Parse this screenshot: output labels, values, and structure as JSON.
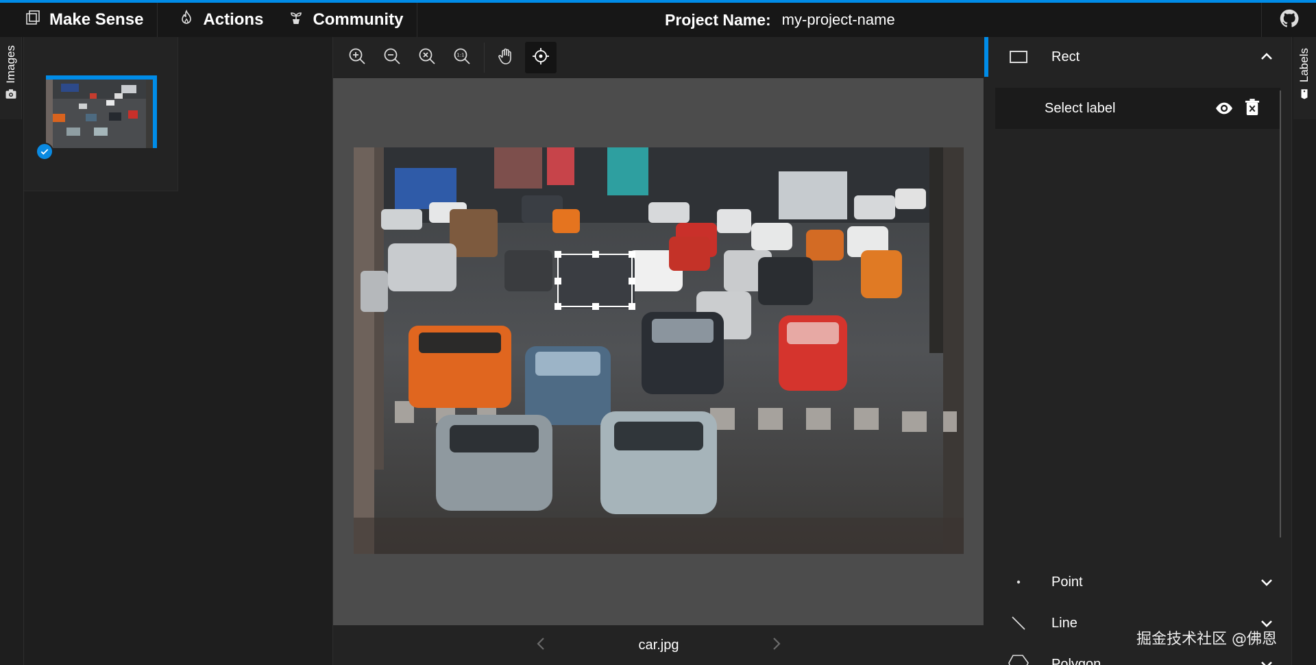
{
  "topbar": {
    "brand": "Make Sense",
    "actions": "Actions",
    "community": "Community",
    "project_label": "Project Name:",
    "project_name": "my-project-name",
    "icons": {
      "brand": "logo-icon",
      "actions": "flame-icon",
      "community": "plant-icon",
      "github": "github-icon"
    }
  },
  "left_tab": {
    "label": "Images"
  },
  "images": [
    {
      "name": "car.jpg",
      "annotated": true,
      "selected": true
    }
  ],
  "editor": {
    "tools": [
      {
        "name": "zoom-in",
        "icon": "zoom-in-icon"
      },
      {
        "name": "zoom-out",
        "icon": "zoom-out-icon"
      },
      {
        "name": "zoom-fit",
        "icon": "zoom-fit-icon"
      },
      {
        "name": "zoom-max",
        "icon": "zoom-one-to-one-icon",
        "glyph": "1:1"
      },
      {
        "name": "pan",
        "icon": "hand-icon"
      },
      {
        "name": "cursor-cross",
        "icon": "crosshair-icon",
        "active": true
      }
    ],
    "filename": "car.jpg"
  },
  "labels_panel": {
    "rect": {
      "label": "Rect",
      "expanded": true
    },
    "label_row": {
      "text": "Select label"
    },
    "point": {
      "label": "Point"
    },
    "line": {
      "label": "Line"
    },
    "polygon": {
      "label": "Polygon"
    }
  },
  "right_tab": {
    "label": "Labels"
  },
  "watermark": "掘金技术社区 @佛恩",
  "colors": {
    "accent": "#008ce8",
    "topbar": "#171717",
    "panel": "#232323",
    "canvas": "#4c4c4c"
  }
}
